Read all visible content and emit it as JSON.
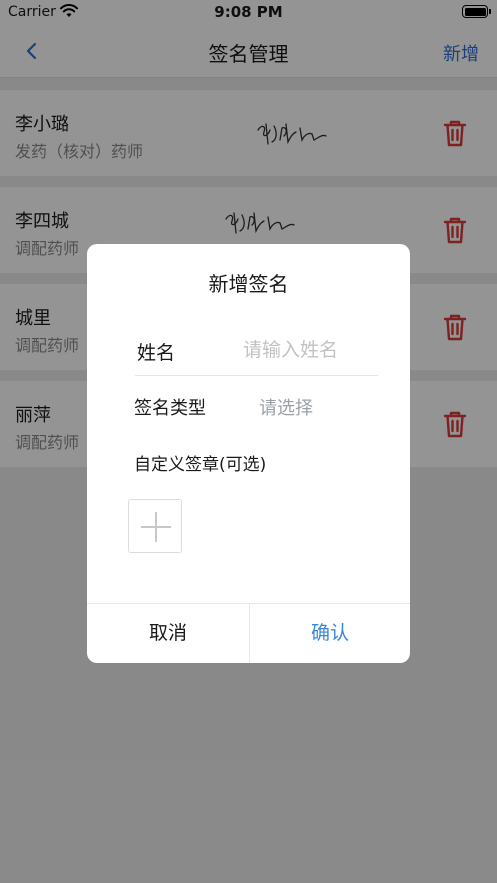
{
  "status_bar": {
    "carrier": "Carrier",
    "time": "9:08 PM"
  },
  "nav": {
    "title": "签名管理",
    "add_label": "新增",
    "back_icon": "chevron-left-icon"
  },
  "list": [
    {
      "name": "李小璐",
      "role": "发药（核对）药师",
      "has_signature": true
    },
    {
      "name": "李四城",
      "role": "调配药师",
      "has_signature": true
    },
    {
      "name": "城里",
      "role": "调配药师",
      "has_signature": false
    },
    {
      "name": "丽萍",
      "role": "调配药师",
      "has_signature": false
    }
  ],
  "colors": {
    "accent": "#2f6fd0",
    "confirm": "#3b86dc",
    "delete": "#d93a3a"
  },
  "dialog": {
    "title": "新增签名",
    "name_label": "姓名",
    "name_placeholder": "请输入姓名",
    "name_value": "",
    "type_label": "签名类型",
    "type_placeholder": "请选择",
    "custom_label": "自定义签章(可选)",
    "upload_icon": "plus-icon",
    "cancel_label": "取消",
    "confirm_label": "确认"
  }
}
